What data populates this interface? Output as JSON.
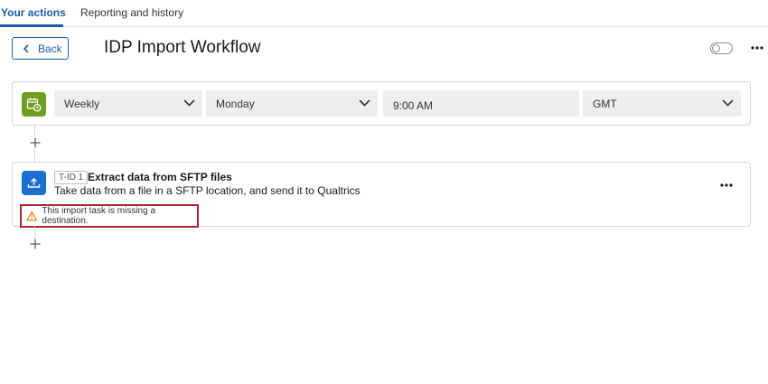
{
  "tabs": [
    {
      "label": "Your actions",
      "active": true
    },
    {
      "label": "Reporting and history",
      "active": false
    }
  ],
  "header": {
    "back_label": "Back",
    "title": "IDP Import Workflow",
    "enabled": false
  },
  "schedule": {
    "icon": "calendar-clock-icon",
    "frequency": "Weekly",
    "day": "Monday",
    "time": "9:00 AM",
    "timezone": "GMT"
  },
  "task": {
    "icon": "upload-icon",
    "id_label": "T-ID 1",
    "title": "Extract data from SFTP files",
    "description": "Take data from a file in a SFTP location, and send it to Qualtrics",
    "warning": "This import task is missing a destination."
  },
  "colors": {
    "accent": "#1a5fa8",
    "schedule_icon_bg": "#6f9d1f",
    "task_icon_bg": "#1a6fd1",
    "warning_border": "#b0243a",
    "warning_icon": "#e07a00"
  }
}
